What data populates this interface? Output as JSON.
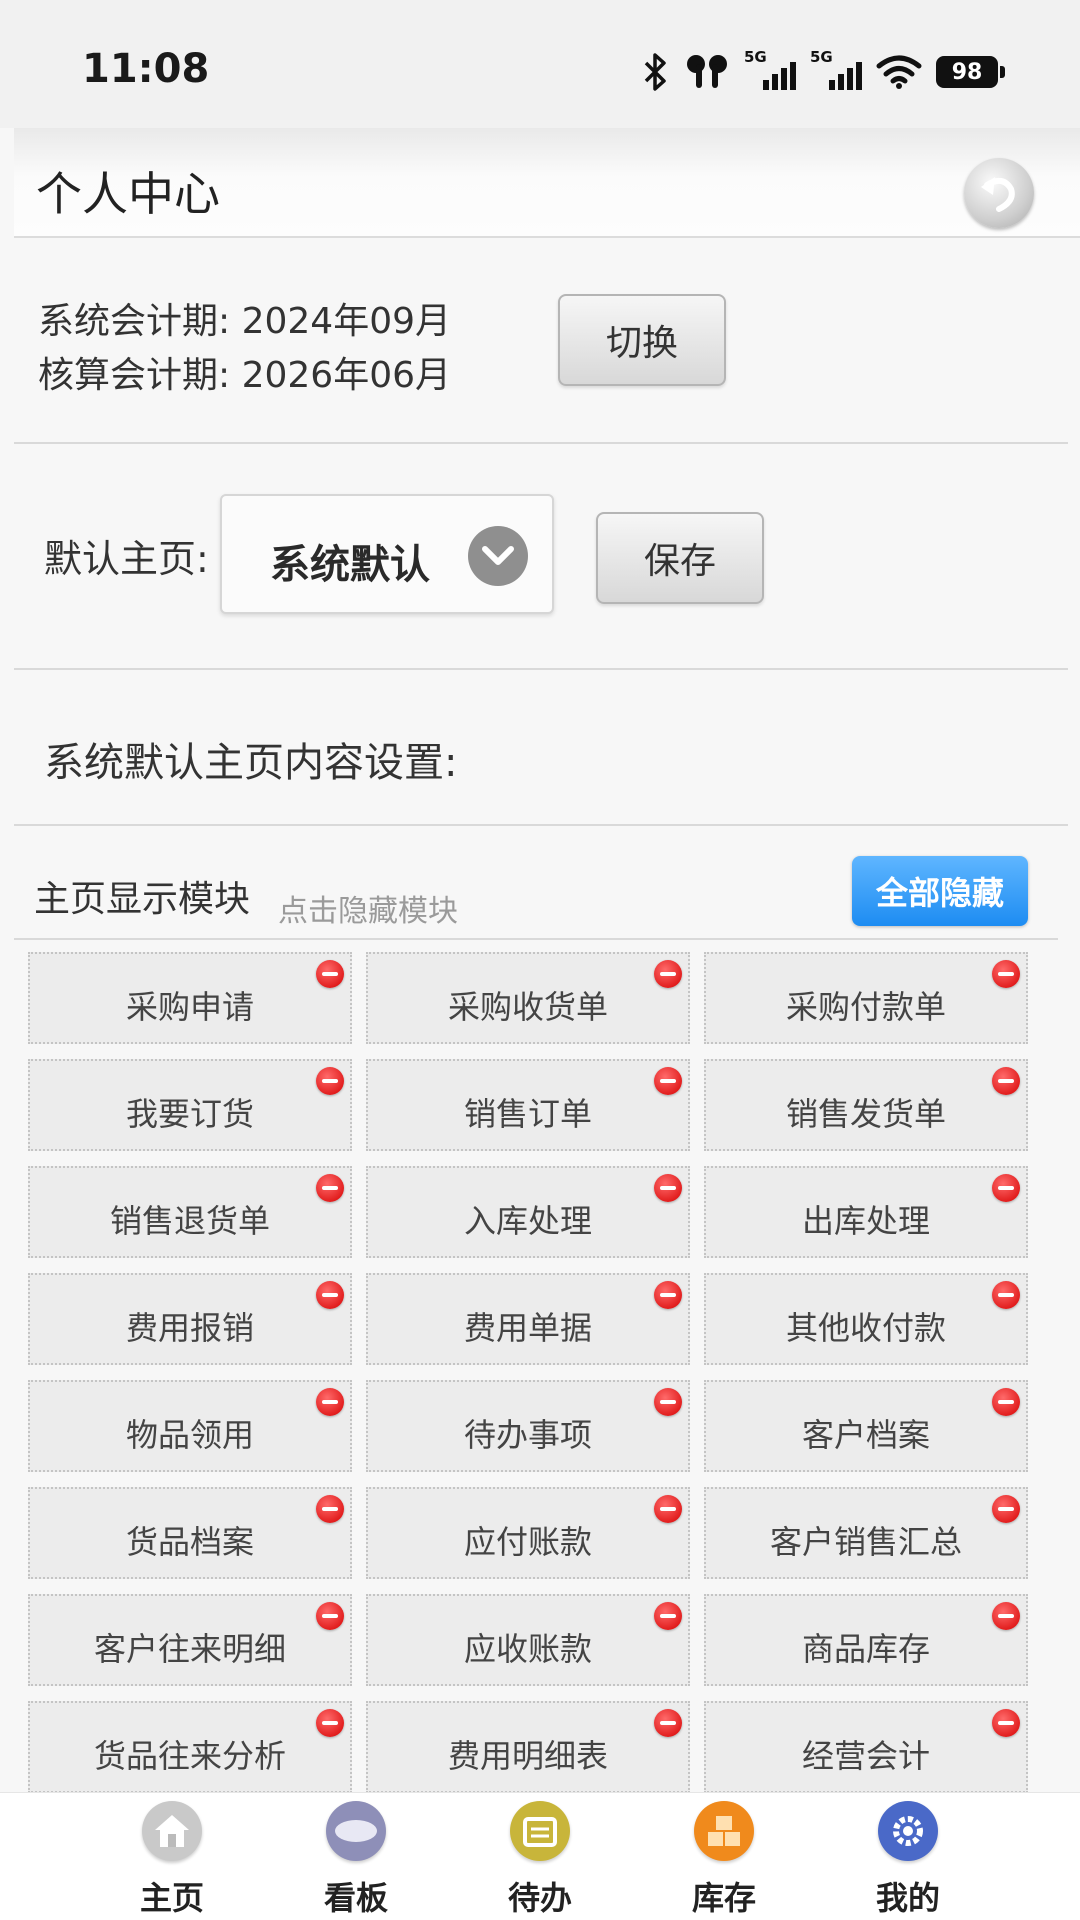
{
  "status_bar": {
    "time": "11:08",
    "network_1": "5G",
    "network_2": "5G",
    "battery": "98"
  },
  "header": {
    "title": "个人中心",
    "back_icon": "back-arrow-icon"
  },
  "accounting": {
    "system_period": "系统会计期: 2024年09月",
    "calc_period": "核算会计期: 2026年06月",
    "switch_label": "切换"
  },
  "default_home": {
    "label": "默认主页:",
    "selected": "系统默认",
    "save_label": "保存"
  },
  "section_title": "系统默认主页内容设置:",
  "modules": {
    "title": "主页显示模块",
    "hint": "点击隐藏模块",
    "hide_all_label": "全部隐藏",
    "items": [
      "采购申请",
      "采购收货单",
      "采购付款单",
      "我要订货",
      "销售订单",
      "销售发货单",
      "销售退货单",
      "入库处理",
      "出库处理",
      "费用报销",
      "费用单据",
      "其他收付款",
      "物品领用",
      "待办事项",
      "客户档案",
      "货品档案",
      "应付账款",
      "客户销售汇总",
      "客户往来明细",
      "应收账款",
      "商品库存",
      "货品往来分析",
      "费用明细表",
      "经营会计"
    ]
  },
  "bottom_nav": [
    {
      "label": "主页",
      "icon": "home-icon",
      "color": "#c9c9c9"
    },
    {
      "label": "看板",
      "icon": "info-board-icon",
      "color": "#8e8fb8"
    },
    {
      "label": "待办",
      "icon": "calendar-icon",
      "color": "#c8b53a"
    },
    {
      "label": "库存",
      "icon": "boxes-icon",
      "color": "#f08a1c"
    },
    {
      "label": "我的",
      "icon": "gear-icon",
      "color": "#4a69c8"
    }
  ]
}
